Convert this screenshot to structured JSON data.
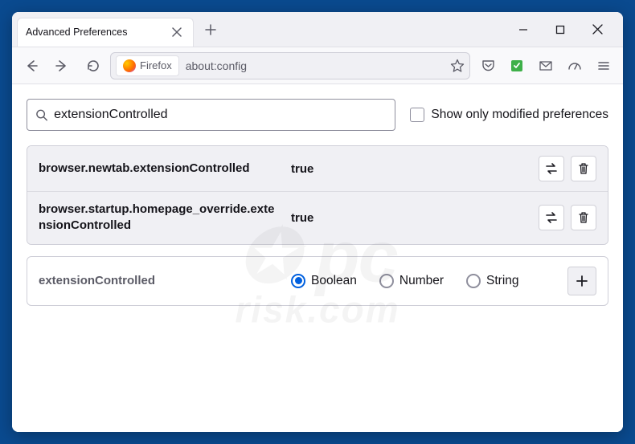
{
  "tab": {
    "title": "Advanced Preferences"
  },
  "urlbar": {
    "identity_label": "Firefox",
    "url": "about:config"
  },
  "search": {
    "value": "extensionControlled",
    "show_modified_label": "Show only modified preferences"
  },
  "prefs": [
    {
      "name": "browser.newtab.extensionControlled",
      "value": "true"
    },
    {
      "name": "browser.startup.homepage_override.extensionControlled",
      "value": "true"
    }
  ],
  "add": {
    "name": "extensionControlled",
    "options": [
      "Boolean",
      "Number",
      "String"
    ],
    "selected": "Boolean"
  }
}
